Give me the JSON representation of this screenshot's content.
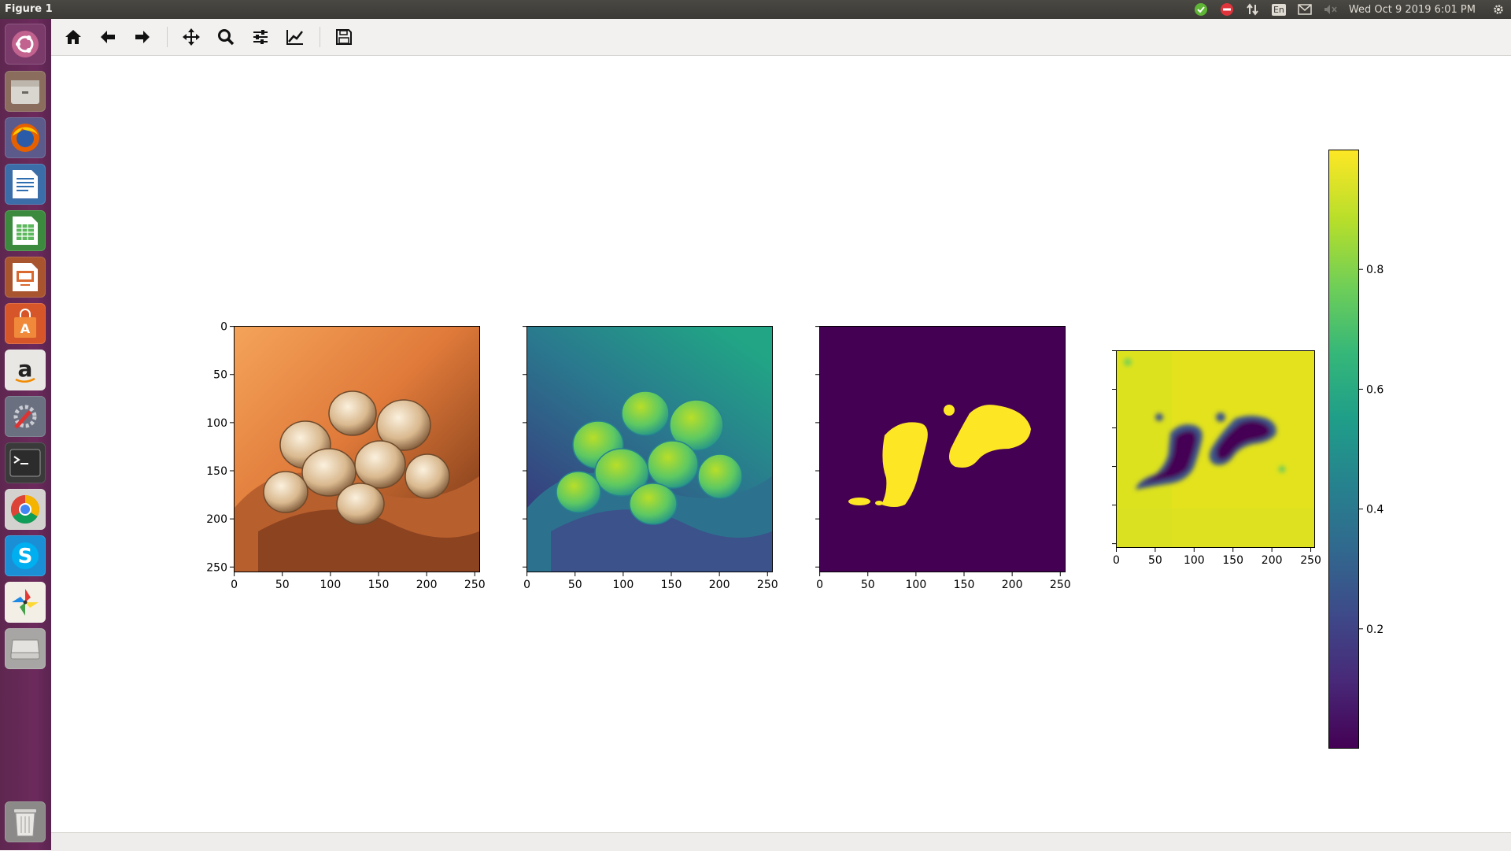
{
  "window": {
    "title": "Figure 1"
  },
  "panel": {
    "clock": "Wed Oct  9 2019  6:01 PM",
    "keyboard_layout": "En",
    "icons": [
      "check-icon",
      "no-entry-icon",
      "network-arrows-icon",
      "keyboard-icon",
      "mail-icon",
      "volume-muted-icon",
      "settings-gear-icon"
    ]
  },
  "launcher": {
    "items": [
      "ubuntu-dash",
      "files",
      "firefox",
      "libreoffice-writer",
      "libreoffice-calc",
      "libreoffice-impress",
      "ubuntu-software",
      "amazon",
      "system-settings",
      "terminal",
      "chrome",
      "skype",
      "pinwheel-app",
      "disk-drive",
      "trash"
    ]
  },
  "toolbar": {
    "buttons": [
      "home",
      "back",
      "forward",
      "pan",
      "zoom",
      "configure-subplots",
      "edit-axes",
      "save"
    ]
  },
  "colors": {
    "viridis_low": "#440154",
    "viridis_high": "#fde725",
    "launcher_bg": "#6c2a5c"
  },
  "figure": {
    "axes": [
      {
        "name": "rgb-image",
        "xticks": [
          "0",
          "50",
          "100",
          "150",
          "200",
          "250"
        ],
        "yticks": [
          "0",
          "50",
          "100",
          "150",
          "200",
          "250"
        ],
        "xlim": [
          0,
          255
        ],
        "ylim": [
          255,
          0
        ]
      },
      {
        "name": "grayscale-viridis-image",
        "xticks": [
          "0",
          "50",
          "100",
          "150",
          "200",
          "250"
        ],
        "yticks": [
          "",
          "",
          "",
          "",
          "",
          ""
        ],
        "xlim": [
          0,
          255
        ],
        "ylim": [
          255,
          0
        ]
      },
      {
        "name": "binary-mask-image",
        "xticks": [
          "0",
          "50",
          "100",
          "150",
          "200",
          "250"
        ],
        "yticks": [
          "",
          "",
          "",
          "",
          "",
          ""
        ],
        "xlim": [
          0,
          255
        ],
        "ylim": [
          255,
          0
        ]
      },
      {
        "name": "probability-map-image",
        "xticks": [
          "0",
          "50",
          "100",
          "150",
          "200",
          "250"
        ],
        "yticks": [
          "",
          "",
          "",
          "",
          "",
          ""
        ],
        "xlim": [
          0,
          255
        ],
        "ylim": [
          255,
          0
        ]
      }
    ],
    "colorbar": {
      "ticks": [
        "0.2",
        "0.4",
        "0.6",
        "0.8"
      ],
      "tick_values": [
        0.2,
        0.4,
        0.6,
        0.8
      ],
      "range": [
        0.0,
        1.0
      ],
      "colormap": "viridis"
    }
  }
}
